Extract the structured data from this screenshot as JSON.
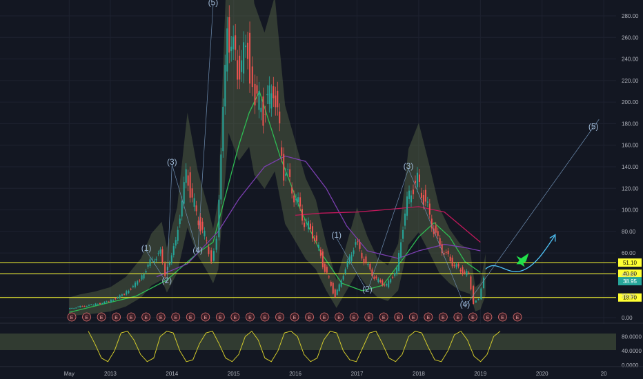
{
  "chart_data": {
    "type": "line",
    "title": "",
    "ylim": [
      0,
      290
    ],
    "y_ticks": [
      "280.00",
      "260.00",
      "240.00",
      "220.00",
      "200.00",
      "180.00",
      "160.00",
      "140.00",
      "120.00",
      "100.00",
      "80.00",
      "60.00",
      "40.00",
      "20.00",
      "0.00"
    ],
    "x_ticks": [
      "May",
      "2013",
      "2014",
      "2015",
      "2016",
      "2017",
      "2018",
      "2019",
      "2020",
      "20"
    ],
    "price_series": {
      "name": "",
      "color": "#26a69a",
      "down_color": "#ef5350",
      "x": [
        "2012-05",
        "2012-07",
        "2012-10",
        "2013-01",
        "2013-04",
        "2013-07",
        "2013-09",
        "2013-11",
        "2013-12",
        "2014-02",
        "2014-04",
        "2014-06",
        "2014-08",
        "2014-09",
        "2014-10",
        "2014-12",
        "2015-02",
        "2015-04",
        "2015-05",
        "2015-07",
        "2015-09",
        "2015-11",
        "2016-01",
        "2016-03",
        "2016-05",
        "2016-07",
        "2016-09",
        "2016-11",
        "2017-01",
        "2017-03",
        "2017-05",
        "2017-07",
        "2017-09",
        "2017-11",
        "2018-01",
        "2018-03",
        "2018-05",
        "2018-07",
        "2018-09",
        "2018-11",
        "2018-12",
        "2019-01",
        "2019-02"
      ],
      "values": [
        8,
        10,
        12,
        15,
        22,
        35,
        52,
        60,
        42,
        70,
        135,
        95,
        70,
        55,
        75,
        270,
        230,
        250,
        210,
        190,
        215,
        140,
        115,
        90,
        75,
        45,
        20,
        45,
        70,
        50,
        35,
        30,
        45,
        110,
        128,
        100,
        70,
        55,
        45,
        40,
        15,
        18,
        38
      ]
    },
    "indicator_lines": [
      {
        "name": "",
        "color": "#2ebd53",
        "x": [
          "2012-05",
          "2013-06",
          "2013-12",
          "2014-06",
          "2014-09",
          "2015-02",
          "2015-04",
          "2015-06",
          "2015-10",
          "2016-02",
          "2016-06",
          "2016-10",
          "2017-02",
          "2017-06",
          "2017-10",
          "2018-01",
          "2018-04",
          "2018-07",
          "2018-10",
          "2019-01"
        ],
        "values": [
          5,
          20,
          35,
          60,
          70,
          160,
          190,
          210,
          150,
          100,
          60,
          32,
          25,
          30,
          55,
          75,
          88,
          75,
          52,
          42
        ]
      },
      {
        "name": "",
        "color": "#7b3fb0",
        "x": [
          "2013-10",
          "2014-04",
          "2014-10",
          "2015-02",
          "2015-07",
          "2015-11",
          "2016-03",
          "2016-07",
          "2016-11",
          "2017-03",
          "2017-09",
          "2018-01",
          "2018-06",
          "2018-10",
          "2019-01"
        ],
        "values": [
          38,
          50,
          80,
          110,
          140,
          150,
          145,
          120,
          85,
          62,
          55,
          62,
          68,
          65,
          62
        ]
      },
      {
        "name": "",
        "color": "#c2185b",
        "x": [
          "2016-01",
          "2016-06",
          "2017-01",
          "2017-06",
          "2018-01",
          "2018-06",
          "2019-01"
        ],
        "values": [
          95,
          97,
          98,
          100,
          103,
          98,
          70
        ]
      }
    ],
    "horizontal_levels": [
      {
        "value": 51.1,
        "label": "51.10",
        "color": "#ffff33"
      },
      {
        "value": 40.8,
        "label": "40.80",
        "color": "#ffff33"
      },
      {
        "value": 18.7,
        "label": "18.70",
        "color": "#ffff33"
      }
    ],
    "current_price": {
      "value": 38.95,
      "label": "38.95",
      "color": "#26a69a"
    },
    "wave_labels": [
      {
        "text": "(1)",
        "x": "2013-08",
        "y": 62
      },
      {
        "text": "(2)",
        "x": "2013-12",
        "y": 32
      },
      {
        "text": "(3)",
        "x": "2014-01",
        "y": 142
      },
      {
        "text": "(4)",
        "x": "2014-06",
        "y": 60
      },
      {
        "text": "(5)",
        "x": "2014-09",
        "y": 290
      },
      {
        "text": "(1)",
        "x": "2016-09",
        "y": 74
      },
      {
        "text": "(2)",
        "x": "2017-03",
        "y": 24
      },
      {
        "text": "(3)",
        "x": "2017-11",
        "y": 138
      },
      {
        "text": "(4)",
        "x": "2018-10",
        "y": 10
      },
      {
        "text": "(5)",
        "x": "2020-11",
        "y": 175
      }
    ],
    "earnings_markers": [
      "E",
      "E",
      "E",
      "E",
      "E",
      "E",
      "E",
      "E",
      "E",
      "E",
      "E",
      "E",
      "E",
      "E",
      "E",
      "E",
      "E",
      "E",
      "E",
      "E",
      "E",
      "E",
      "E",
      "E",
      "E",
      "E",
      "E",
      "E",
      "E",
      "E",
      "E"
    ],
    "oscillator": {
      "y_ticks": [
        "80.0000",
        "40.0000",
        "0.0000"
      ],
      "color": "#d4cc2b",
      "ylim": [
        0,
        100
      ],
      "values": [
        95,
        60,
        20,
        10,
        40,
        90,
        95,
        70,
        30,
        10,
        20,
        80,
        95,
        90,
        40,
        10,
        15,
        60,
        90,
        95,
        60,
        20,
        10,
        30,
        80,
        95,
        70,
        20,
        10,
        40,
        90,
        95,
        80,
        30,
        10,
        20,
        70,
        95,
        90,
        40,
        15,
        10,
        50,
        90,
        95,
        60,
        20,
        10,
        30,
        80,
        95,
        90,
        50,
        15,
        10,
        40,
        85,
        95,
        70,
        25,
        10,
        30,
        80,
        95
      ]
    }
  }
}
